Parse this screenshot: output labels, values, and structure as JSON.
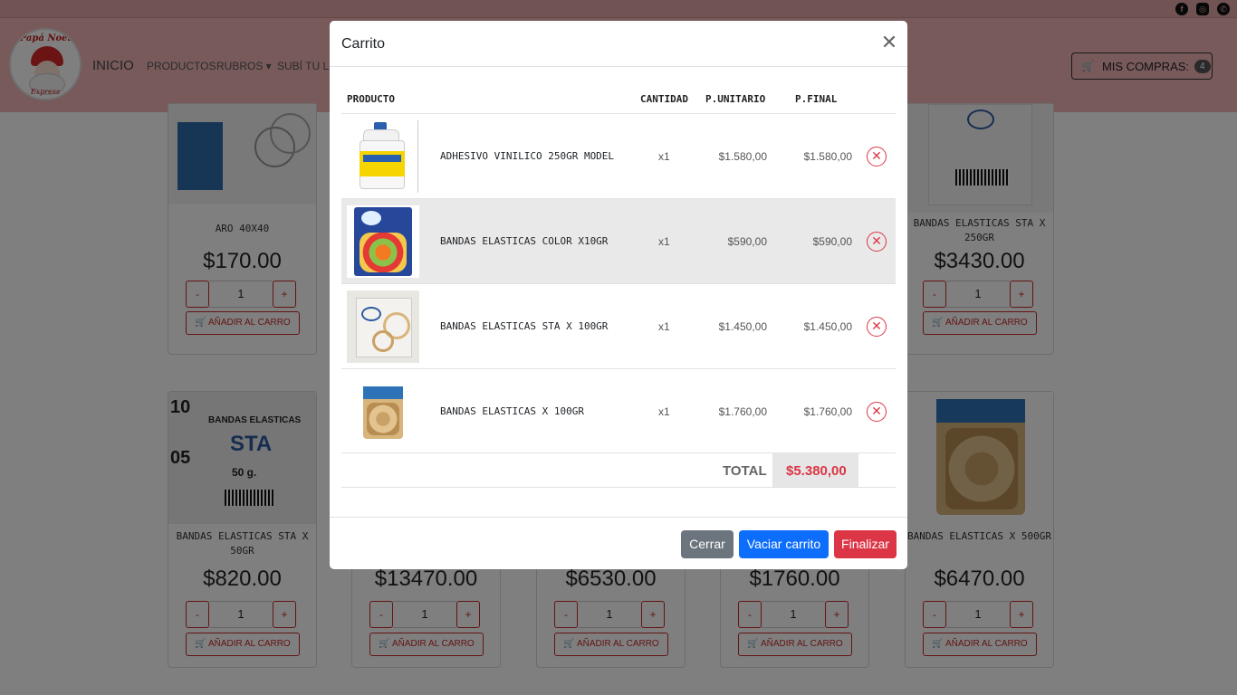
{
  "social_icons": [
    "facebook-icon",
    "instagram-icon",
    "whatsapp-icon"
  ],
  "brand": {
    "line1": "Papá Noel",
    "line2": "Express"
  },
  "nav": {
    "home": "INICIO",
    "products": "PRODUCTOS",
    "rubros": "RUBROS ▾",
    "upload": "SUBÍ TU LIS",
    "cart_label": "MIS COMPRAS:",
    "cart_count": "4"
  },
  "catalog": {
    "row1": [
      {
        "name": "ARO 40X40",
        "price": "$170.00",
        "qty": "1",
        "add_label": "AÑADIR AL CARRO"
      },
      {
        "name": "BANDAS ELASTICAS STA X 250GR",
        "price": "$3430.00",
        "qty": "1",
        "add_label": "AÑADIR AL CARRO"
      }
    ],
    "row2": [
      {
        "name": "BANDAS ELASTICAS STA X 50GR",
        "price": "$820.00",
        "qty": "1",
        "add_label": "AÑADIR AL CARRO",
        "img_text": [
          "10",
          "05",
          "BANDAS ELASTICAS",
          "STA",
          "50 g."
        ]
      },
      {
        "name": "",
        "price": "$13470.00",
        "qty": "1",
        "add_label": "AÑADIR AL CARRO"
      },
      {
        "name": "",
        "price": "$6530.00",
        "qty": "1",
        "add_label": "AÑADIR AL CARRO"
      },
      {
        "name": "",
        "price": "$1760.00",
        "qty": "1",
        "add_label": "AÑADIR AL CARRO"
      },
      {
        "name": "BANDAS ELASTICAS X 500GR",
        "price": "$6470.00",
        "qty": "1",
        "add_label": "AÑADIR AL CARRO"
      }
    ],
    "minus": "-",
    "plus": "+"
  },
  "modal": {
    "title": "Carrito",
    "headers": {
      "product": "PRODUCTO",
      "qty": "CANTIDAD",
      "unit": "P.UNITARIO",
      "final": "P.FINAL"
    },
    "items": [
      {
        "name": "ADHESIVO VINILICO 250GR MODEL",
        "qty": "x1",
        "unit": "$1.580,00",
        "final": "$1.580,00"
      },
      {
        "name": "BANDAS ELASTICAS COLOR X10GR",
        "qty": "x1",
        "unit": "$590,00",
        "final": "$590,00"
      },
      {
        "name": "BANDAS ELASTICAS STA X 100GR",
        "qty": "x1",
        "unit": "$1.450,00",
        "final": "$1.450,00"
      },
      {
        "name": "BANDAS ELASTICAS X 100GR",
        "qty": "x1",
        "unit": "$1.760,00",
        "final": "$1.760,00"
      }
    ],
    "total_label": "TOTAL",
    "total_value": "$5.380,00",
    "buttons": {
      "close": "Cerrar",
      "empty": "Vaciar carrito",
      "finish": "Finalizar"
    }
  },
  "colors": {
    "navbar": "#f1b5b5",
    "accent_red": "#dc3545",
    "primary_blue": "#0d6efd",
    "secondary_gray": "#6c757d"
  }
}
